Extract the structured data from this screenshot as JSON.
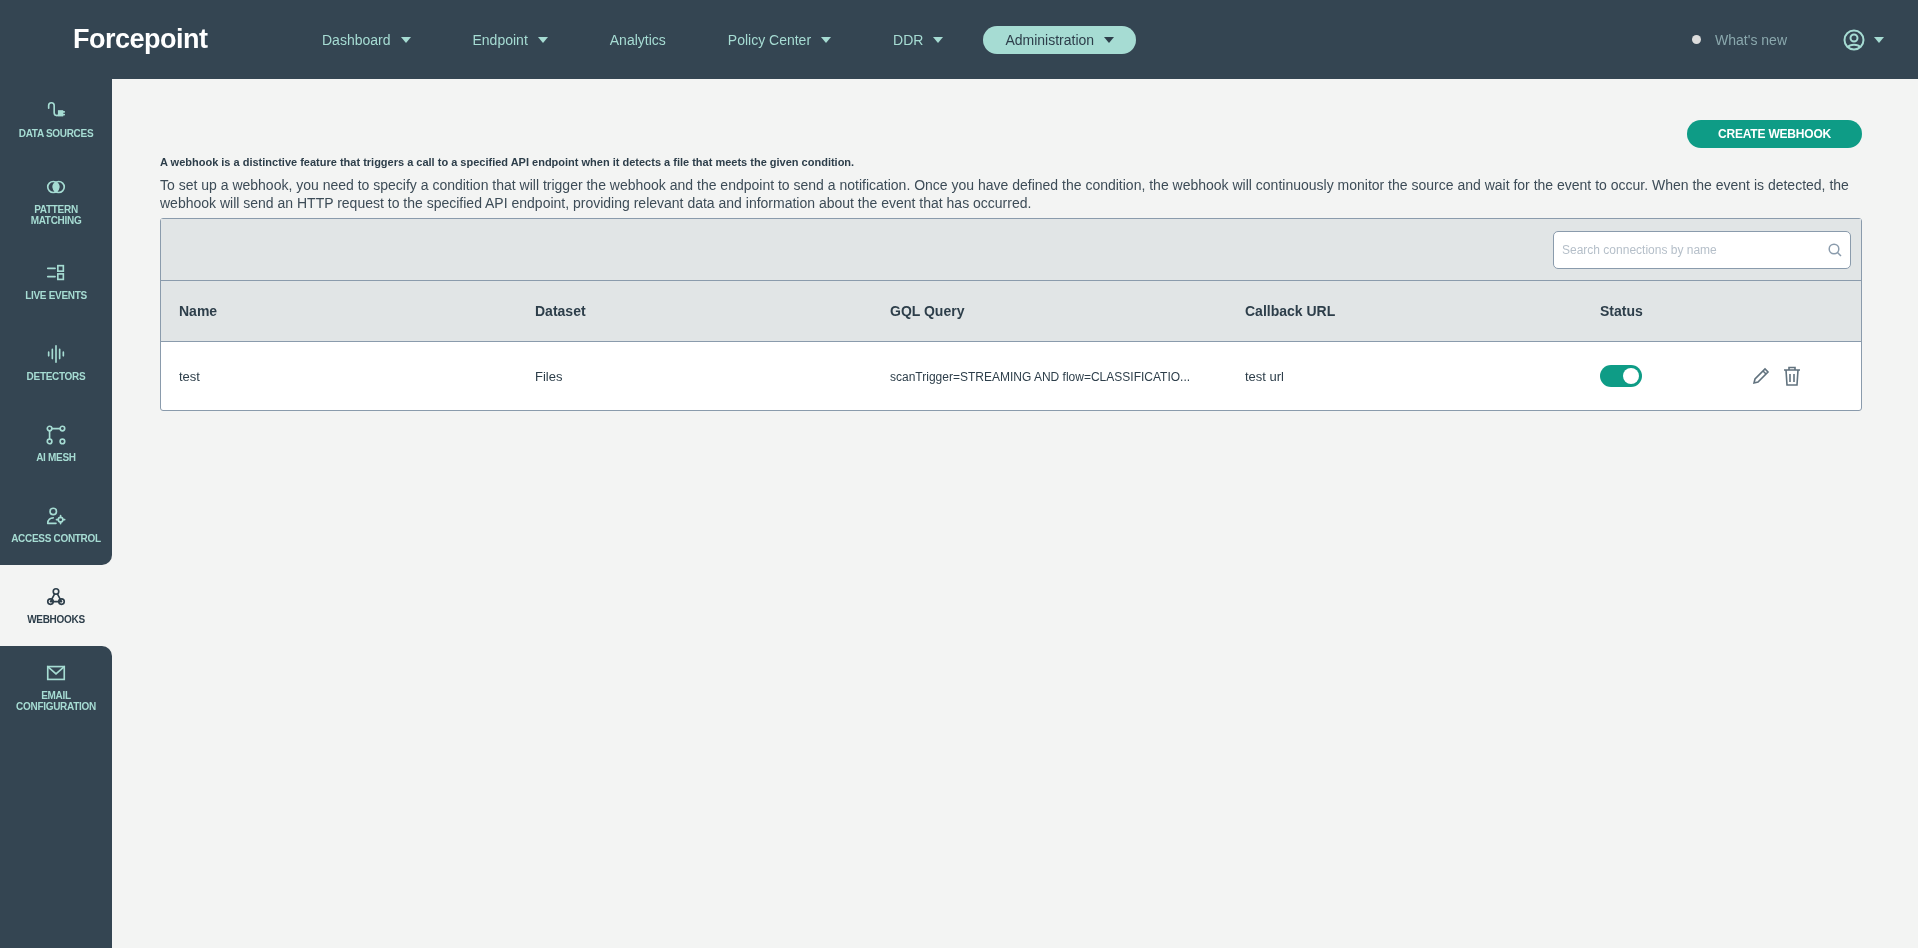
{
  "topbar": {
    "logo": "Forcepoint",
    "nav": [
      {
        "label": "Dashboard",
        "dropdown": true,
        "selected": false
      },
      {
        "label": "Endpoint",
        "dropdown": true,
        "selected": false
      },
      {
        "label": "Analytics",
        "dropdown": false,
        "selected": false
      },
      {
        "label": "Policy Center",
        "dropdown": true,
        "selected": false
      },
      {
        "label": "DDR",
        "dropdown": true,
        "selected": false
      },
      {
        "label": "Administration",
        "dropdown": true,
        "selected": true
      }
    ],
    "whats_new": "What's new"
  },
  "sidebar": {
    "items": [
      {
        "label": "DATA SOURCES",
        "selected": false
      },
      {
        "label": "PATTERN\nMATCHING",
        "selected": false
      },
      {
        "label": "LIVE EVENTS",
        "selected": false
      },
      {
        "label": "DETECTORS",
        "selected": false
      },
      {
        "label": "AI MESH",
        "selected": false
      },
      {
        "label": "ACCESS CONTROL",
        "selected": false
      },
      {
        "label": "WEBHOOKS",
        "selected": true
      },
      {
        "label": "EMAIL\nCONFIGURATION",
        "selected": false
      }
    ]
  },
  "main": {
    "create_button": "CREATE WEBHOOK",
    "intro": "A webhook is a distinctive feature that triggers a call to a specified API endpoint when it detects a file that meets the given condition.",
    "description": "To set up a webhook, you need to specify a condition that will trigger the webhook and the endpoint to send a notification. Once you have defined the condition, the webhook will continuously monitor the source and wait for the event to occur. When the event is detected, the webhook will send an HTTP request to the specified API endpoint, providing relevant data and information about the event that has occurred.",
    "search": {
      "placeholder": "Search connections by name"
    },
    "table": {
      "columns": [
        "Name",
        "Dataset",
        "GQL Query",
        "Callback URL",
        "Status"
      ],
      "rows": [
        {
          "name": "test",
          "dataset": "Files",
          "gql_query": "scanTrigger=STREAMING AND flow=CLASSIFICATIO...",
          "callback_url": "test url",
          "on": true
        }
      ]
    }
  }
}
